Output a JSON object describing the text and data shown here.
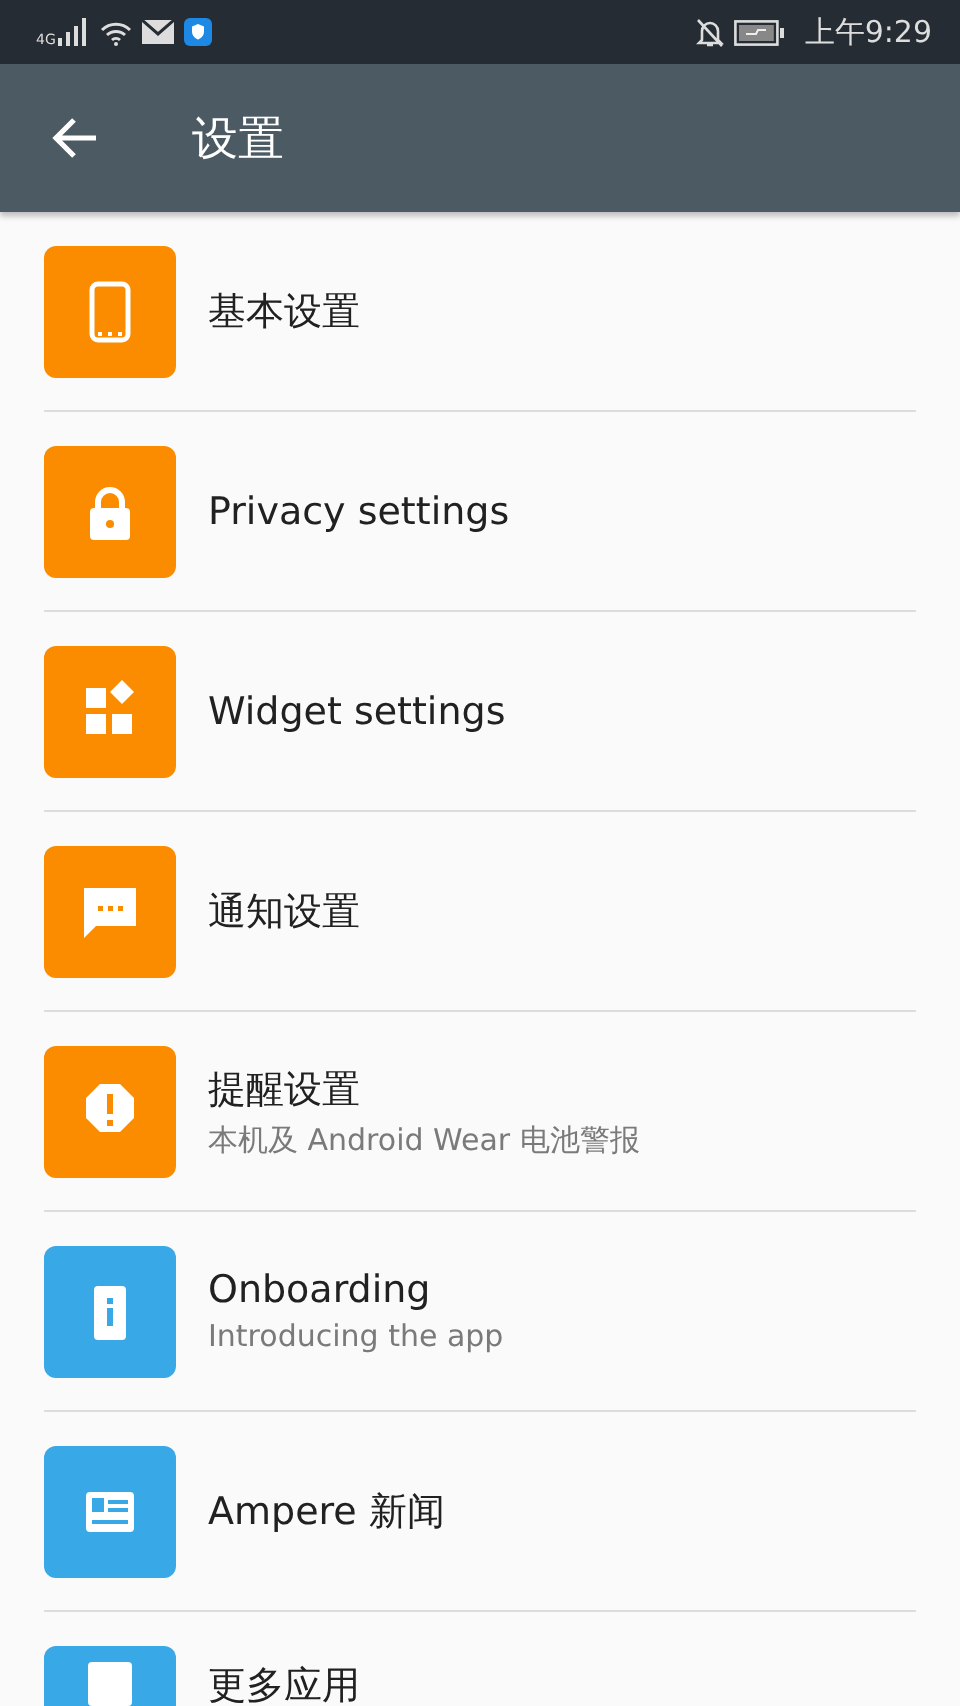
{
  "status_bar": {
    "network": "4G",
    "time": "上午9:29"
  },
  "app_bar": {
    "title": "设置"
  },
  "items": [
    {
      "title": "基本设置",
      "color": "#fb8c00"
    },
    {
      "title": "Privacy settings",
      "color": "#fb8c00"
    },
    {
      "title": "Widget settings",
      "color": "#fb8c00"
    },
    {
      "title": "通知设置",
      "color": "#fb8c00"
    },
    {
      "title": "提醒设置",
      "subtitle": "本机及 Android Wear 电池警报",
      "color": "#fb8c00"
    },
    {
      "title": "Onboarding",
      "subtitle": "Introducing the app",
      "color": "#39a8e6"
    },
    {
      "title": "Ampere 新闻",
      "color": "#39a8e6"
    },
    {
      "title": "更多应用",
      "color": "#39a8e6"
    }
  ]
}
